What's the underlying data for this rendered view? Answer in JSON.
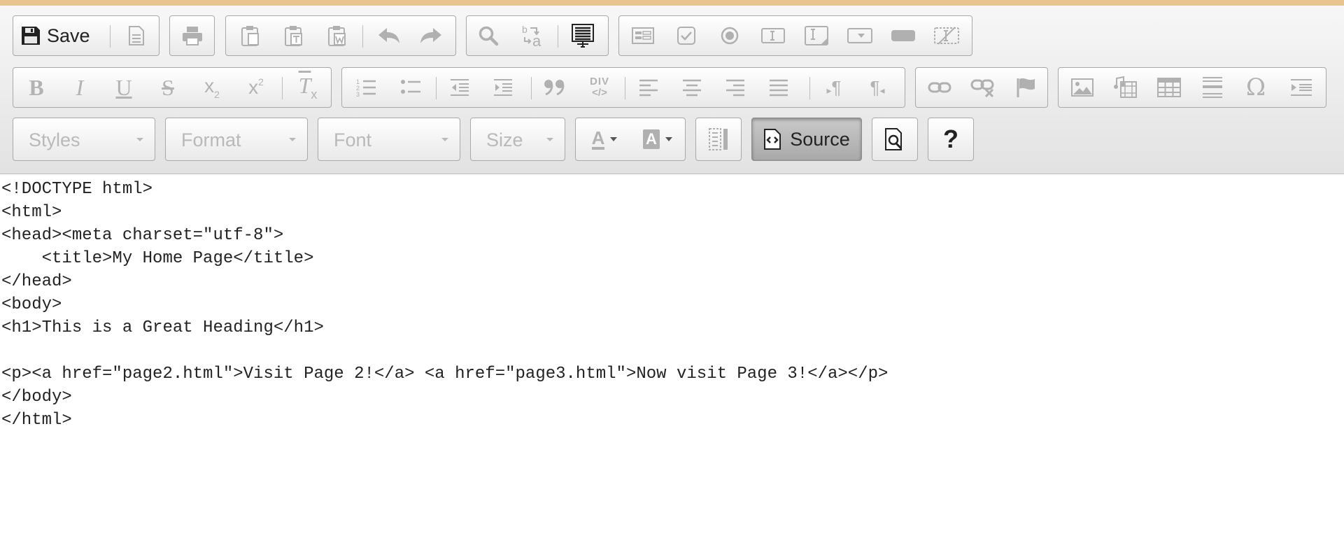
{
  "toolbar": {
    "save_label": "Save",
    "source_label": "Source",
    "help_label": "?",
    "combos": {
      "styles": "Styles",
      "format": "Format",
      "font": "Font",
      "size": "Size"
    },
    "glyphs": {
      "bold": "B",
      "italic": "I",
      "underline": "U",
      "strike": "S",
      "subscript": "x",
      "subscript_mark": "2",
      "superscript": "x",
      "superscript_mark": "2",
      "remove_format": "T",
      "remove_format_mark": "x",
      "blockquote": "”",
      "div_top": "DIV",
      "div_bottom": "</>",
      "bidi_ltr": "¶",
      "bidi_rtl": "¶",
      "special_char": "Ω",
      "text_color": "A",
      "bg_color": "A"
    }
  },
  "editor": {
    "lines": [
      "<!DOCTYPE html>",
      "<html>",
      "<head><meta charset=\"utf-8\">",
      "    <title>My Home Page</title>",
      "</head>",
      "<body>",
      "<h1>This is a Great Heading</h1>",
      "",
      "<p><a href=\"page2.html\">Visit Page 2!</a> <a href=\"page3.html\">Now visit Page 3!</a></p>",
      "</body>",
      "</html>"
    ]
  }
}
